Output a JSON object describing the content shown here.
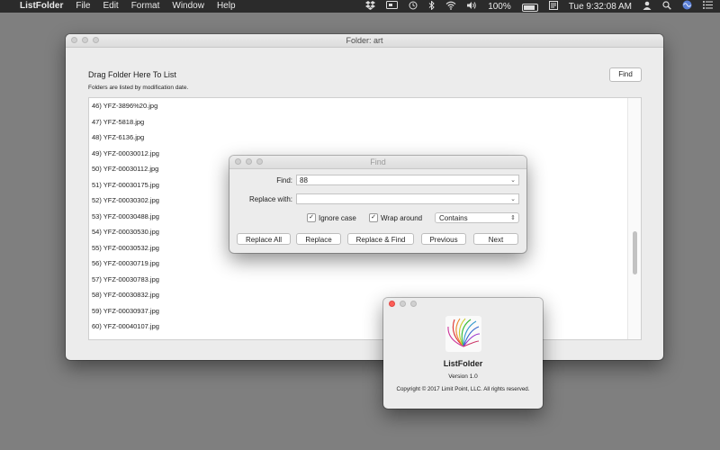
{
  "menubar": {
    "app_name": "ListFolder",
    "items": [
      "File",
      "Edit",
      "Format",
      "Window",
      "Help"
    ],
    "battery": "100%",
    "clock": "Tue 9:32:08 AM"
  },
  "main_window": {
    "title": "Folder: art",
    "drag_label": "Drag Folder Here To List",
    "sub_label": "Folders are listed by modification date.",
    "find_button": "Find",
    "rows": [
      "46) YFZ-3896%20.jpg",
      "47) YFZ-5818.jpg",
      "48) YFZ-6136.jpg",
      "49) YFZ-00030012.jpg",
      "50) YFZ-00030112.jpg",
      "51) YFZ-00030175.jpg",
      "52) YFZ-00030302.jpg",
      "53) YFZ-00030488.jpg",
      "54) YFZ-00030530.jpg",
      "55) YFZ-00030532.jpg",
      "56) YFZ-00030719.jpg",
      "57) YFZ-00030783.jpg",
      "58) YFZ-00030832.jpg",
      "59) YFZ-00030937.jpg",
      "60) YFZ-00040107.jpg"
    ]
  },
  "find_panel": {
    "title": "Find",
    "find_label": "Find:",
    "find_value": "88",
    "replace_label": "Replace with:",
    "replace_value": "",
    "ignore_case": "Ignore case",
    "wrap_around": "Wrap around",
    "match_mode": "Contains",
    "buttons": {
      "replace_all": "Replace All",
      "replace": "Replace",
      "replace_find": "Replace & Find",
      "previous": "Previous",
      "next": "Next"
    }
  },
  "about_window": {
    "app_name": "ListFolder",
    "version": "Version 1.0",
    "copyright": "Copyright © 2017 Limit Point, LLC. All rights reserved."
  }
}
